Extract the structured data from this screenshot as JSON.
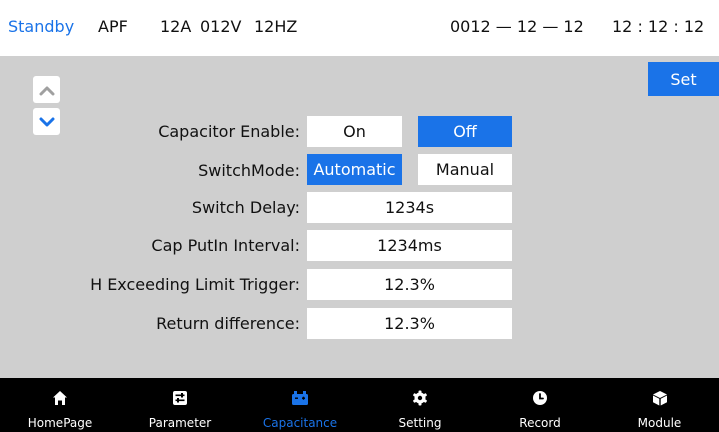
{
  "status": {
    "state": "Standby",
    "mode": "APF",
    "current": "12A",
    "voltage": "012V",
    "frequency": "12HZ",
    "date": "0012 — 12 — 12",
    "time": "12 : 12 : 12",
    "state_color": "#1a73e8"
  },
  "controls": {
    "up_icon": "chevron-up-icon",
    "down_icon": "chevron-down-icon",
    "set_label": "Set"
  },
  "fields": {
    "capacitor_enable": {
      "label": "Capacitor Enable:",
      "on": "On",
      "off": "Off",
      "selected": "Off"
    },
    "switch_mode": {
      "label": "SwitchMode:",
      "automatic": "Automatic",
      "manual": "Manual",
      "selected": "Automatic"
    },
    "switch_delay": {
      "label": "Switch Delay:",
      "value": "1234s"
    },
    "cap_putin_interval": {
      "label": "Cap PutIn Interval:",
      "value": "1234ms"
    },
    "h_exceeding_limit": {
      "label": "H Exceeding Limit Trigger:",
      "value": "12.3%"
    },
    "return_difference": {
      "label": "Return difference:",
      "value": "12.3%"
    }
  },
  "nav": {
    "items": [
      {
        "label": "HomePage",
        "icon": "home-icon"
      },
      {
        "label": "Parameter",
        "icon": "sliders-icon"
      },
      {
        "label": "Capacitance",
        "icon": "battery-icon"
      },
      {
        "label": "Setting",
        "icon": "gear-icon"
      },
      {
        "label": "Record",
        "icon": "clock-icon"
      },
      {
        "label": "Module",
        "icon": "cube-icon"
      }
    ],
    "active_index": 2,
    "active_color": "#1a73e8"
  }
}
